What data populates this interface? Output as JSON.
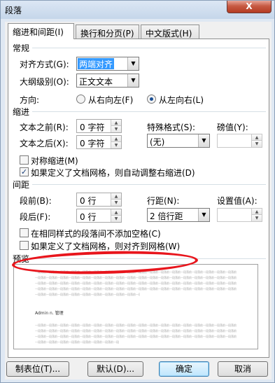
{
  "window": {
    "title": "段落",
    "close": "X"
  },
  "tabs": [
    {
      "label": "缩进和间距(I)"
    },
    {
      "label": "换行和分页(P)"
    },
    {
      "label": "中文版式(H)"
    }
  ],
  "general": {
    "section": "常规",
    "alignment_label": "对齐方式(G):",
    "alignment_value": "两端对齐",
    "outline_label": "大纲级别(O):",
    "outline_value": "正文文本",
    "direction_label": "方向:",
    "rtl_label": "从右向左(F)",
    "ltr_label": "从左向右(L)",
    "direction_selected": "ltr"
  },
  "indent": {
    "section": "缩进",
    "before_label": "文本之前(R):",
    "before_value": "0 字符",
    "after_label": "文本之后(X):",
    "after_value": "0 字符",
    "special_label": "特殊格式(S):",
    "special_value": "(无)",
    "measure_label": "磅值(Y):",
    "measure_value": "",
    "mirror_label": "对称缩进(M)",
    "mirror_checked": false,
    "auto_adjust_label": "如果定义了文档网格，则自动调整右缩进(D)",
    "auto_adjust_checked": true
  },
  "spacing": {
    "section": "间距",
    "before_label": "段前(B):",
    "before_value": "0 行",
    "after_label": "段后(F):",
    "after_value": "0 行",
    "line_spacing_label": "行距(N):",
    "line_spacing_value": "2 倍行距",
    "at_label": "设置值(A):",
    "at_value": "",
    "no_space_label": "在相同样式的段落间不添加空格(C)",
    "no_space_checked": false,
    "snap_grid_label": "如果定义了文档网格，则对齐到网格(W)",
    "snap_grid_checked": false
  },
  "preview": {
    "section": "预览",
    "sample_text": "Admin n. 管理",
    "filler": "一段落前一段落前一段落前一段落前一段落前一段落前一段落前一段落前一段落前一段落前一段落前一段落前一段落前一段落前一段落前一段落前一段落前一段落前"
  },
  "buttons": {
    "tabs": "制表位(T)...",
    "default": "默认(D)...",
    "ok": "确定",
    "cancel": "取消"
  },
  "annotation": {
    "color": "#e8151c"
  }
}
